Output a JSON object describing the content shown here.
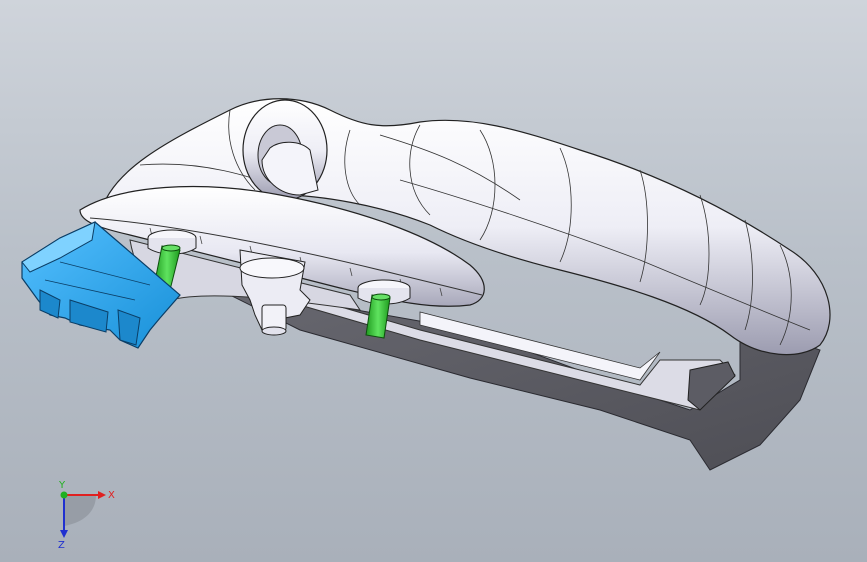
{
  "viewport": {
    "background_top": "#cfd4db",
    "background_bottom": "#a9b0ba"
  },
  "model": {
    "body_color": "#f2f2f8",
    "body_shadow": "#8e8e9e",
    "dark_face": "#5f5f66",
    "connector_color": "#2fa8f0",
    "pin_color": "#33cc33"
  },
  "triad": {
    "x_label": "X",
    "y_label": "Y",
    "z_label": "Z",
    "x_color": "#e02020",
    "y_color": "#20b020",
    "z_color": "#2030d0"
  }
}
